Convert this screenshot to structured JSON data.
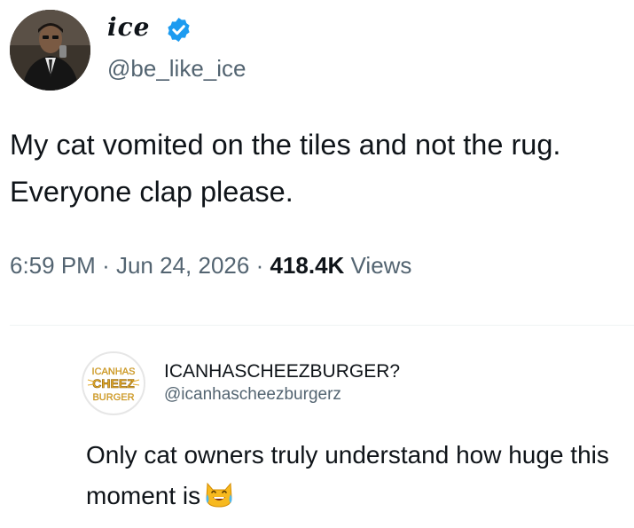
{
  "tweet": {
    "author": {
      "name": "ice",
      "handle": "@be_like_ice",
      "verified": true,
      "badge_color": "#1d9bf0"
    },
    "text": "My cat vomited on the tiles and not the rug. Everyone clap please.",
    "time": "6:59 PM",
    "separator": "·",
    "date": "Jun 24, 2026",
    "views_count": "418.4K",
    "views_label": "Views"
  },
  "quote": {
    "author": {
      "name": "ICANHASCHEEZBURGER?",
      "handle": "@icanhascheezburgerz",
      "logo_lines": [
        "ICANHAS",
        "CHEEZ",
        "BURGER"
      ]
    },
    "text": "Only cat owners truly understand how huge this moment is",
    "emoji": "cat-tears-of-joy-emoji"
  },
  "colors": {
    "text_primary": "#0f1419",
    "text_secondary": "#536471",
    "logo_gold": "#e3a929",
    "emoji_yellow": "#f7b91f"
  }
}
